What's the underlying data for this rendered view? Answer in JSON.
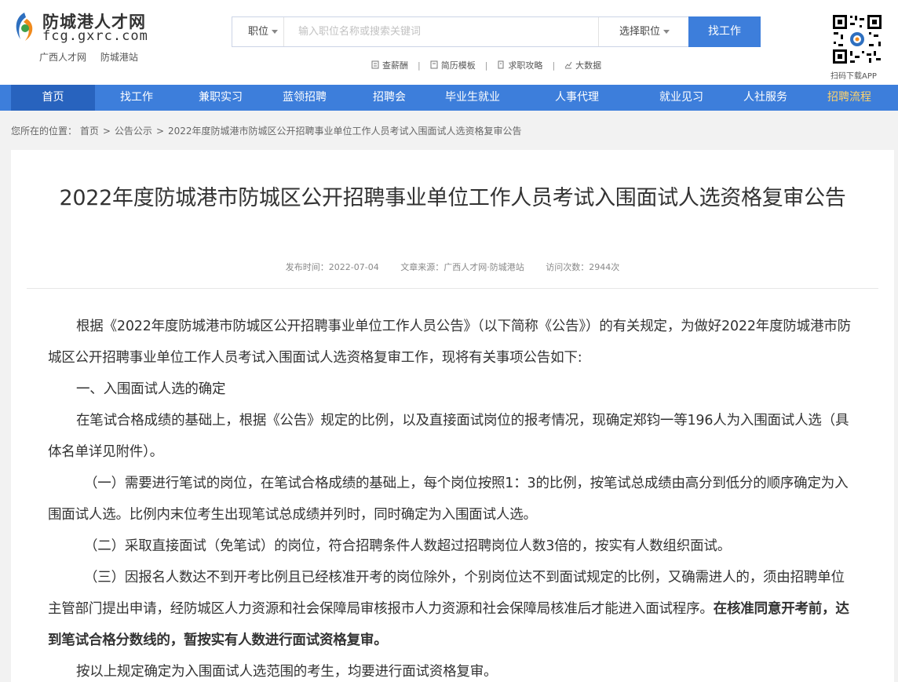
{
  "header": {
    "logo_name": "防城港人才网",
    "logo_url": "fcg.gxrc.com",
    "logo_links": [
      "广西人才网",
      "防城港站"
    ],
    "search": {
      "type_label": "职位",
      "placeholder": "输入职位名称或搜索关键词",
      "position_label": "选择职位",
      "button": "找工作"
    },
    "quick_links": [
      "查薪酬",
      "简历模板",
      "求职攻略",
      "大数据"
    ],
    "qr_label": "扫码下载APP"
  },
  "nav": [
    "首页",
    "找工作",
    "兼职实习",
    "蓝领招聘",
    "招聘会",
    "毕业生就业",
    "人事代理",
    "就业见习",
    "人社服务",
    "招聘流程"
  ],
  "breadcrumb": {
    "prefix": "您所在的位置：",
    "items": [
      "首页",
      "公告公示",
      "2022年度防城港市防城区公开招聘事业单位工作人员考试入围面试人选资格复审公告"
    ]
  },
  "article": {
    "title": "2022年度防城港市防城区公开招聘事业单位工作人员考试入围面试人选资格复审公告",
    "meta": {
      "publish_time": "发布时间：2022-07-04",
      "source": "文章来源：广西人才网·防城港站",
      "views": "访问次数：2944次"
    },
    "paragraphs": [
      "根据《2022年度防城港市防城区公开招聘事业单位工作人员公告》（以下简称《公告》）的有关规定，为做好2022年度防城港市防城区公开招聘事业单位工作人员考试入围面试人选资格复审工作，现将有关事项公告如下:",
      "一、入围面试人选的确定",
      "在笔试合格成绩的基础上，根据《公告》规定的比例，以及直接面试岗位的报考情况，现确定郑钧一等196人为入围面试人选（具体名单详见附件）。",
      "（一）需要进行笔试的岗位，在笔试合格成绩的基础上，每个岗位按照1：3的比例，按笔试总成绩由高分到低分的顺序确定为入围面试人选。比例内末位考生出现笔试总成绩并列时，同时确定为入围面试人选。",
      "（二）采取直接面试（免笔试）的岗位，符合招聘条件人数超过招聘岗位人数3倍的，按实有人数组织面试。",
      "（三）因报名人数达不到开考比例且已经核准开考的岗位除外，个别岗位达不到面试规定的比例，又确需进人的，须由招聘单位主管部门提出申请，经防城区人力资源和社会保障局审核报市人力资源和社会保障局核准后才能进入面试程序。",
      "在核准同意开考前，达到笔试合格分数线的，暂按实有人数进行面试资格复审。",
      "按以上规定确定为入围面试人选范围的考生，均要进行面试资格复审。"
    ]
  },
  "colors": {
    "primary": "#3d7edb",
    "nav_active": "#2863be",
    "nav_highlight": "#ffd36b"
  }
}
